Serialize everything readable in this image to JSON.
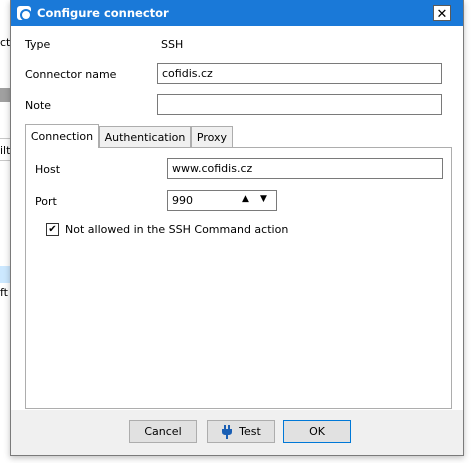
{
  "background_window": {
    "fragment_top": "cts",
    "fragment_mid": "ilti",
    "fragment_low": "ft S"
  },
  "dialog": {
    "title": "Configure connector",
    "close_label": "✕"
  },
  "fields": {
    "type_label": "Type",
    "type_value": "SSH",
    "name_label": "Connector name",
    "name_value": "cofidis.cz",
    "note_label": "Note",
    "note_value": ""
  },
  "tabs": [
    {
      "label": "Connection",
      "active": true
    },
    {
      "label": "Authentication",
      "active": false
    },
    {
      "label": "Proxy",
      "active": false
    }
  ],
  "connection": {
    "host_label": "Host",
    "host_value": "www.cofidis.cz",
    "port_label": "Port",
    "port_value": "990",
    "checkbox_checked": true,
    "checkbox_mark": "✔",
    "checkbox_label": "Not allowed in the SSH Command action"
  },
  "buttons": {
    "cancel": "Cancel",
    "test": "Test",
    "ok": "OK"
  },
  "colors": {
    "title_bar": "#1a79d8",
    "button_face": "#e1e1e1",
    "plug_icon": "#1a5fb4"
  }
}
